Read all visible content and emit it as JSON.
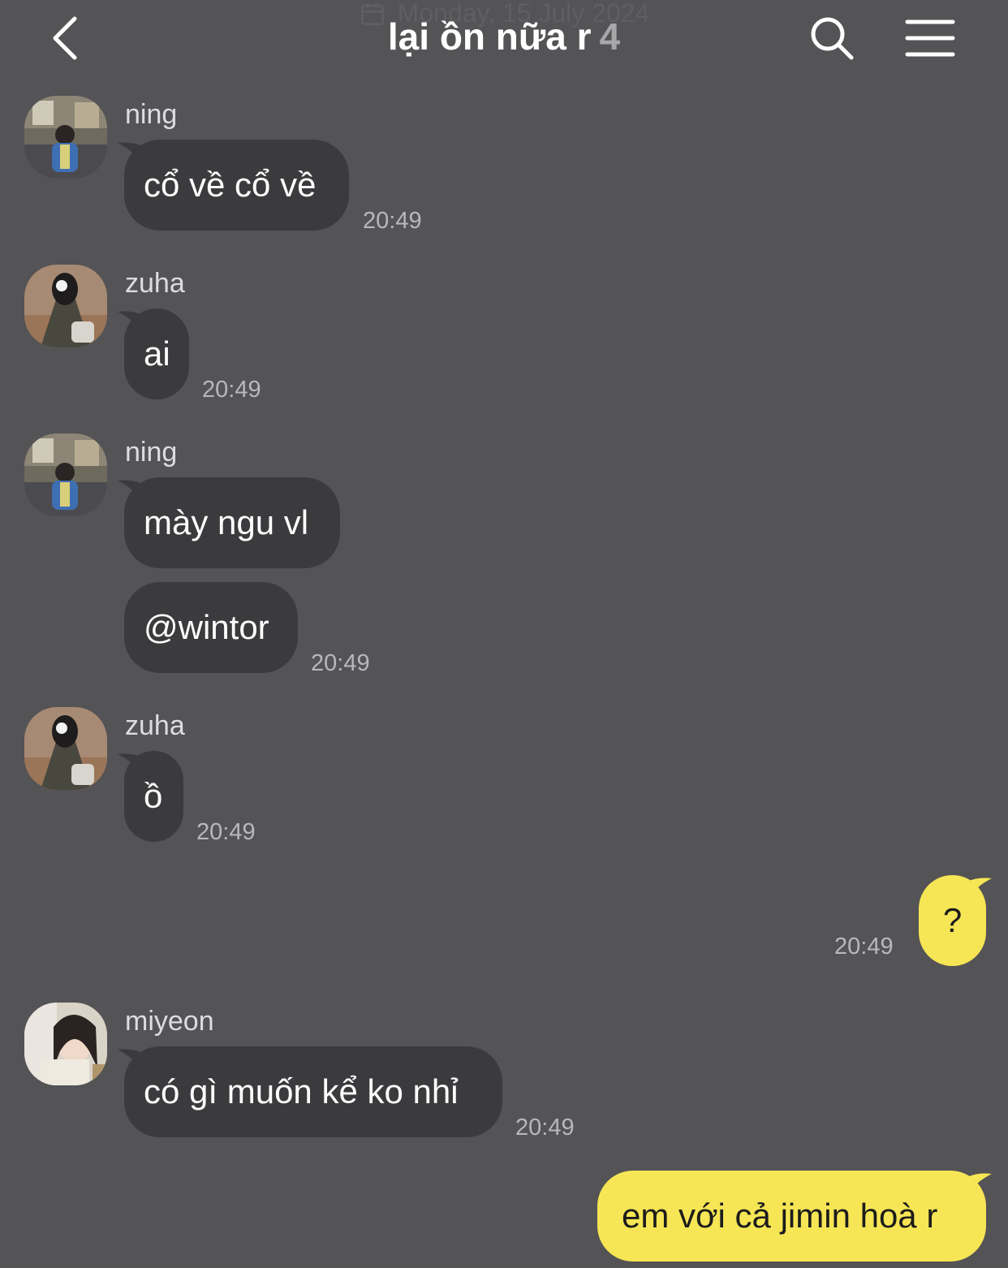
{
  "date_banner": "Monday, 15 July 2024",
  "header": {
    "title": "lại ồn nữa r",
    "member_count": "4"
  },
  "messages": [
    {
      "sender": "ning",
      "text": "cổ về cổ về",
      "time": "20:49"
    },
    {
      "sender": "zuha",
      "text": "ai",
      "time": "20:49"
    },
    {
      "sender": "ning",
      "text": "mày ngu vl",
      "time": ""
    },
    {
      "sender": "",
      "text": "@wintor",
      "time": "20:49"
    },
    {
      "sender": "zuha",
      "text": "ồ",
      "time": "20:49"
    },
    {
      "sender": "me",
      "text": "?",
      "time": "20:49"
    },
    {
      "sender": "miyeon",
      "text": "có gì muốn kể ko nhỉ",
      "time": "20:49"
    },
    {
      "sender": "me",
      "text": "em với cả jimin hoà r",
      "time": ""
    }
  ],
  "colors": {
    "background": "#545355",
    "incoming_bubble": "#3b3a3d",
    "outgoing_bubble": "#f6e655"
  }
}
